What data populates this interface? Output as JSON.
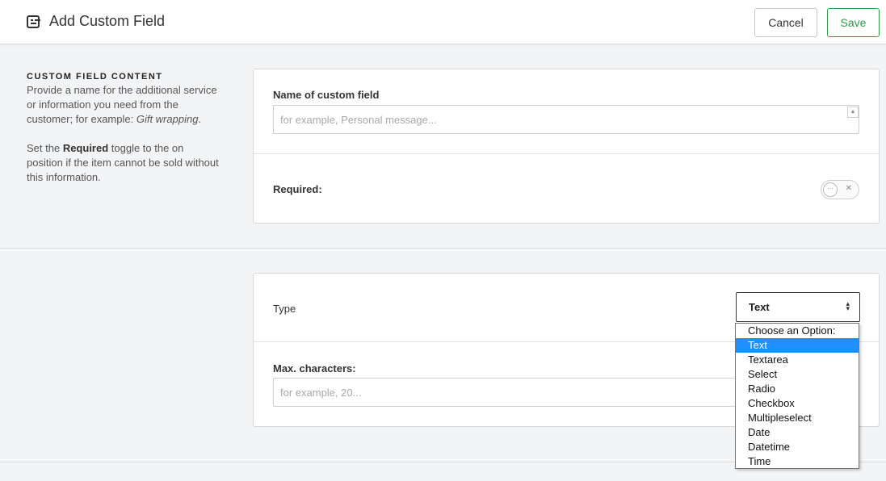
{
  "header": {
    "title": "Add Custom Field",
    "icon": "form-icon",
    "cancel_label": "Cancel",
    "save_label": "Save"
  },
  "section_content": {
    "heading": "CUSTOM FIELD CONTENT",
    "para1_text": "Provide a name for the additional service or information you need from the customer; for example: ",
    "para1_example": "Gift wrapping",
    "para1_end": ".",
    "para2_start": "Set the ",
    "para2_bold": "Required",
    "para2_end": " toggle to the on position if the item cannot be sold without this information."
  },
  "name_field": {
    "label": "Name of custom field",
    "placeholder": "for example, Personal message..."
  },
  "required": {
    "label": "Required:",
    "state": "off"
  },
  "type_field": {
    "label": "Type",
    "selected": "Text",
    "options": [
      "Choose an Option:",
      "Text",
      "Textarea",
      "Select",
      "Radio",
      "Checkbox",
      "Multipleselect",
      "Date",
      "Datetime",
      "Time"
    ]
  },
  "max_chars": {
    "label": "Max. characters:",
    "placeholder": "for example, 20..."
  },
  "colors": {
    "save_accent": "#2e9a47",
    "selected_option": "#1e90ff"
  }
}
